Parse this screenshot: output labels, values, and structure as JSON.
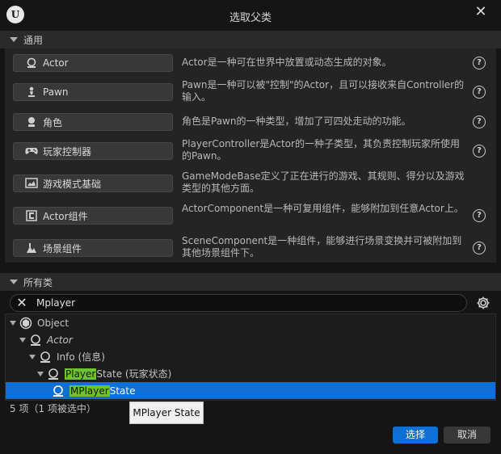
{
  "window": {
    "title": "选取父类",
    "close_symbol": "✕",
    "logo_letter": "U"
  },
  "common": {
    "header": "通用",
    "items": [
      {
        "label": "Actor",
        "icon": "actor-icon",
        "description": "Actor是一种可在世界中放置或动态生成的对象。"
      },
      {
        "label": "Pawn",
        "icon": "pawn-icon",
        "description": "Pawn是一种可以被\"控制\"的Actor，且可以接收来自Controller的输入。"
      },
      {
        "label": "角色",
        "icon": "character-icon",
        "description": "角色是Pawn的一种类型，增加了可四处走动的功能。"
      },
      {
        "label": "玩家控制器",
        "icon": "gamepad-icon",
        "description": "PlayerController是Actor的一种子类型，其负责控制玩家所使用的Pawn。"
      },
      {
        "label": "游戏模式基础",
        "icon": "game-mode-icon",
        "description": "GameModeBase定义了正在进行的游戏、其规则、得分以及游戏类型的其他方面。"
      },
      {
        "label": "Actor组件",
        "icon": "actor-component-icon",
        "description": "ActorComponent是一种可复用组件，能够附加到任意Actor上。"
      },
      {
        "label": "场景组件",
        "icon": "scene-component-icon",
        "description": "SceneComponent是一种组件，能够进行场景变换并可被附加到其他场景组件下。"
      }
    ],
    "help_symbol": "?"
  },
  "all_classes": {
    "header": "所有类",
    "search": {
      "value": "Mplayer",
      "clear_symbol": "✕"
    },
    "tree": [
      {
        "pre": "",
        "hl": "",
        "post": "Object",
        "italic": false,
        "icon": "object-icon"
      },
      {
        "pre": "",
        "hl": "",
        "post": "Actor",
        "italic": true,
        "icon": "actor-icon"
      },
      {
        "pre": "",
        "hl": "",
        "post": "Info (信息)",
        "italic": false,
        "icon": "info-icon"
      },
      {
        "pre": "",
        "hl": "Player",
        "post": "State (玩家状态)",
        "italic": false,
        "icon": "player-state-icon"
      },
      {
        "pre": "",
        "hl": "MPlayer",
        "post": "State",
        "italic": false,
        "icon": "player-state-icon",
        "selected": true
      }
    ],
    "status": "5 项（1 项被选中）",
    "tooltip": "MPlayer State"
  },
  "buttons": {
    "select": "选择",
    "cancel": "取消"
  },
  "colors": {
    "accent": "#0e6fd5",
    "highlight": "#6ec524"
  }
}
